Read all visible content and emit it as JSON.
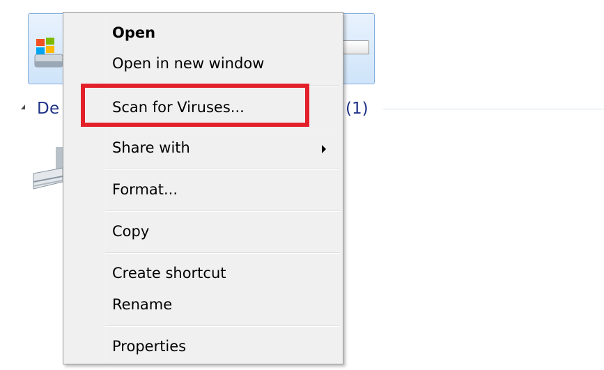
{
  "explorer": {
    "group_title": "De",
    "group_count": "(1)"
  },
  "context_menu": {
    "items": [
      {
        "label": "Open",
        "bold": true
      },
      {
        "label": "Open in new window"
      },
      {
        "label": "Scan for Viruses..."
      },
      {
        "label": "Share with",
        "submenu": true
      },
      {
        "label": "Format..."
      },
      {
        "label": "Copy"
      },
      {
        "label": "Create shortcut"
      },
      {
        "label": "Rename"
      },
      {
        "label": "Properties"
      }
    ]
  },
  "annotation": {
    "highlight_color": "#e3202a",
    "highlighted_item": "Scan for Viruses..."
  },
  "colors": {
    "selection_fill": "#cfe4fa",
    "selection_border": "#84acdd",
    "group_text": "#1e3287",
    "menu_background": "#f0f0f0"
  },
  "icons": {
    "drive": "windows-drive-icon",
    "disc": "optical-drive-icon"
  }
}
